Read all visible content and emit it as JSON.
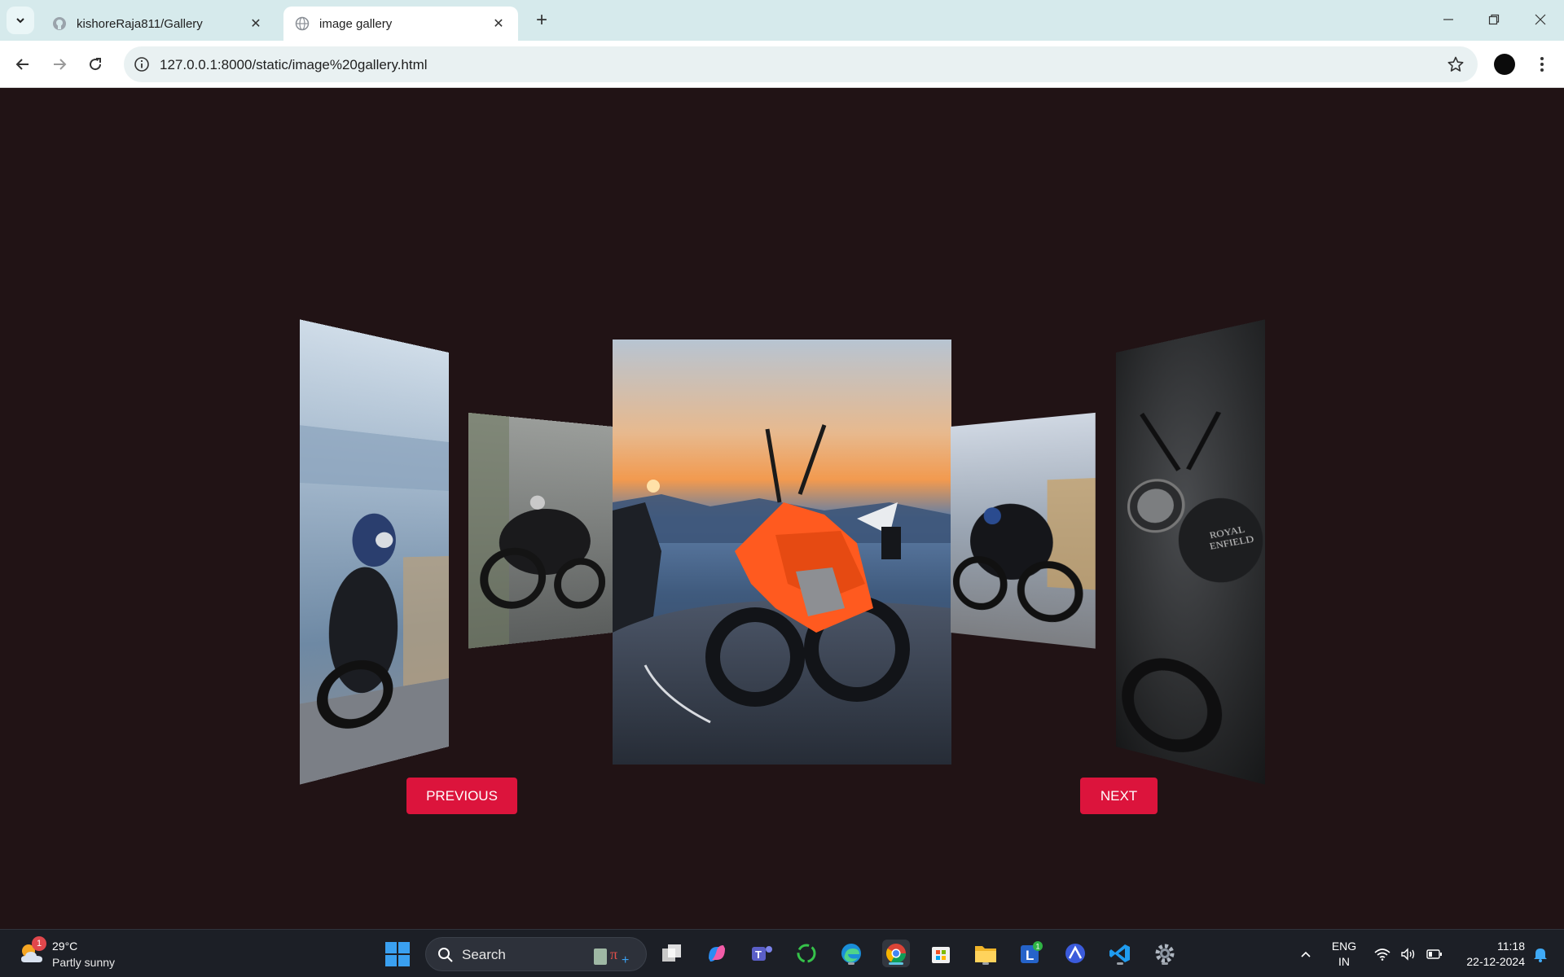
{
  "browser": {
    "tabs": [
      {
        "title": "kishoreRaja811/Gallery",
        "icon": "github-icon",
        "active": false
      },
      {
        "title": "image gallery",
        "icon": "globe-icon",
        "active": true
      }
    ],
    "url": "127.0.0.1:8000/static/image%20gallery.html"
  },
  "gallery": {
    "images": [
      {
        "position": "far-left",
        "subject": "motorcycle-cityscape"
      },
      {
        "position": "near-left",
        "subject": "motorcycle-road"
      },
      {
        "position": "center",
        "subject": "orange-motorcycle-sunset"
      },
      {
        "position": "near-right",
        "subject": "motorcycle-town"
      },
      {
        "position": "far-right",
        "subject": "black-motorcycle"
      }
    ],
    "previous_label": "PREVIOUS",
    "next_label": "NEXT",
    "button_color": "#dc143c",
    "background_color": "#211315"
  },
  "taskbar": {
    "weather": {
      "temp": "29°C",
      "condition": "Partly sunny",
      "badge": "1"
    },
    "search_label": "Search",
    "apps": [
      "calculator-icon",
      "task-view-icon",
      "copilot-icon",
      "teams-icon",
      "sync-icon",
      "edge-icon",
      "chrome-icon",
      "store-icon",
      "file-explorer-icon",
      "launcher-icon",
      "arc-icon",
      "vscode-icon",
      "settings-icon"
    ],
    "launcher_badge": "1",
    "language": {
      "line1": "ENG",
      "line2": "IN"
    },
    "clock": {
      "time": "11:18",
      "date": "22-12-2024"
    }
  }
}
